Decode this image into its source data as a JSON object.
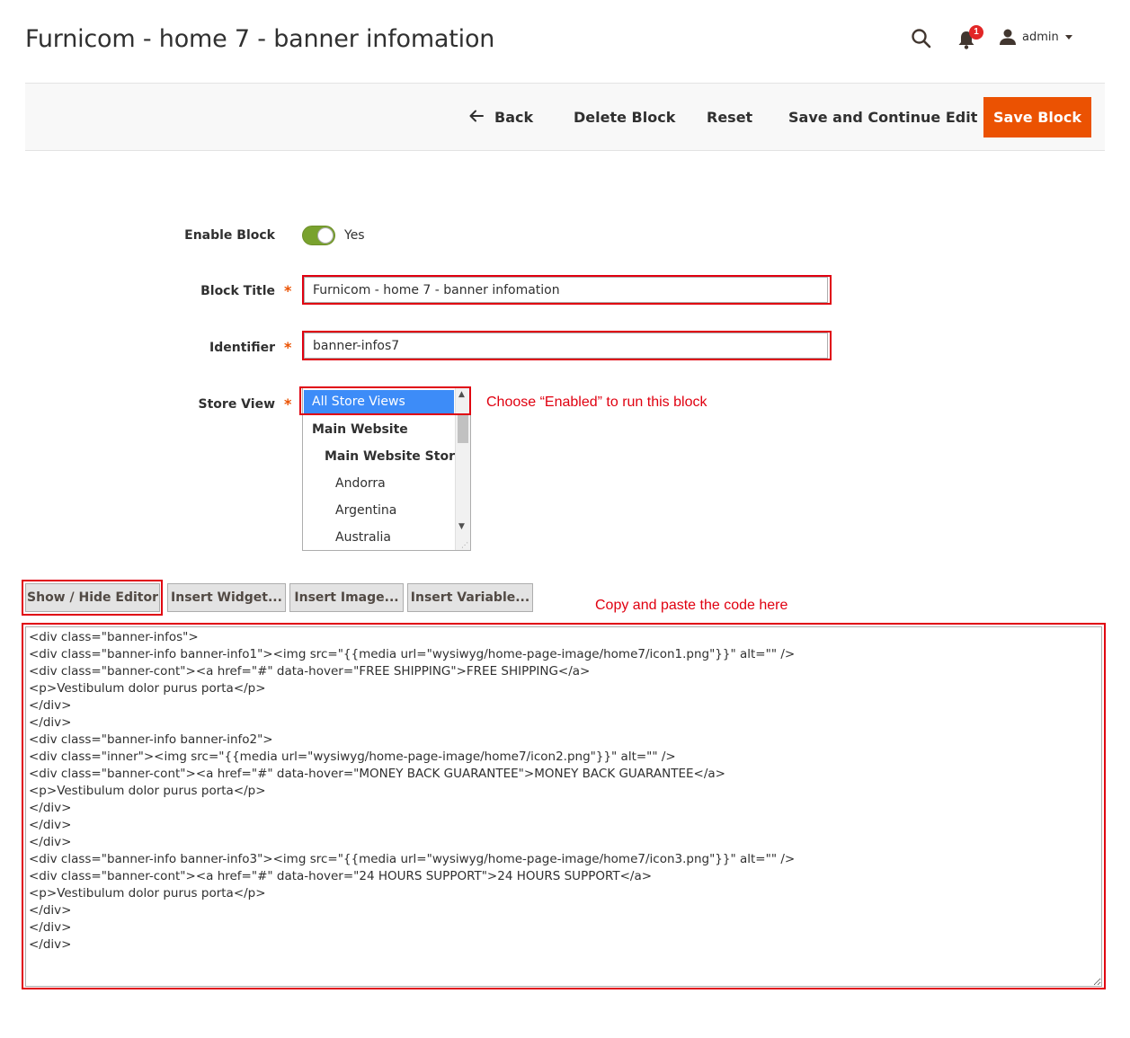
{
  "header": {
    "title": "Furnicom - home 7 - banner infomation",
    "notifications_count": "1",
    "user_name": "admin"
  },
  "toolbar": {
    "back_label": "Back",
    "delete_label": "Delete Block",
    "reset_label": "Reset",
    "save_continue_label": "Save and Continue Edit",
    "save_label": "Save Block"
  },
  "form": {
    "enable_label": "Enable Block",
    "enable_value": "Yes",
    "title_label": "Block Title",
    "title_value": "Furnicom - home 7 - banner infomation",
    "identifier_label": "Identifier",
    "identifier_value": "banner-infos7",
    "store_view_label": "Store View",
    "required_mark": "*",
    "store_options": [
      "All Store Views",
      "Main Website",
      "Main Website Store",
      "Andorra",
      "Argentina",
      "Australia"
    ]
  },
  "annotations": {
    "store_hint": "Choose “Enabled” to run this block",
    "code_hint": "Copy and paste the code here"
  },
  "editor": {
    "show_hide_label": "Show / Hide Editor",
    "insert_widget_label": "Insert Widget...",
    "insert_image_label": "Insert Image...",
    "insert_variable_label": "Insert Variable...",
    "content": "<div class=\"banner-infos\">\n<div class=\"banner-info banner-info1\"><img src=\"{{media url=\"wysiwyg/home-page-image/home7/icon1.png\"}}\" alt=\"\" />\n<div class=\"banner-cont\"><a href=\"#\" data-hover=\"FREE SHIPPING\">FREE SHIPPING</a>\n<p>Vestibulum dolor purus porta</p>\n</div>\n</div>\n<div class=\"banner-info banner-info2\">\n<div class=\"inner\"><img src=\"{{media url=\"wysiwyg/home-page-image/home7/icon2.png\"}}\" alt=\"\" />\n<div class=\"banner-cont\"><a href=\"#\" data-hover=\"MONEY BACK GUARANTEE\">MONEY BACK GUARANTEE</a>\n<p>Vestibulum dolor purus porta</p>\n</div>\n</div>\n</div>\n<div class=\"banner-info banner-info3\"><img src=\"{{media url=\"wysiwyg/home-page-image/home7/icon3.png\"}}\" alt=\"\" />\n<div class=\"banner-cont\"><a href=\"#\" data-hover=\"24 HOURS SUPPORT\">24 HOURS SUPPORT</a>\n<p>Vestibulum dolor purus porta</p>\n</div>\n</div>\n</div>"
  },
  "colors": {
    "accent": "#eb5202",
    "highlight": "#e00010",
    "toggle_on": "#79a22e",
    "selected_option": "#3d8cf8"
  }
}
